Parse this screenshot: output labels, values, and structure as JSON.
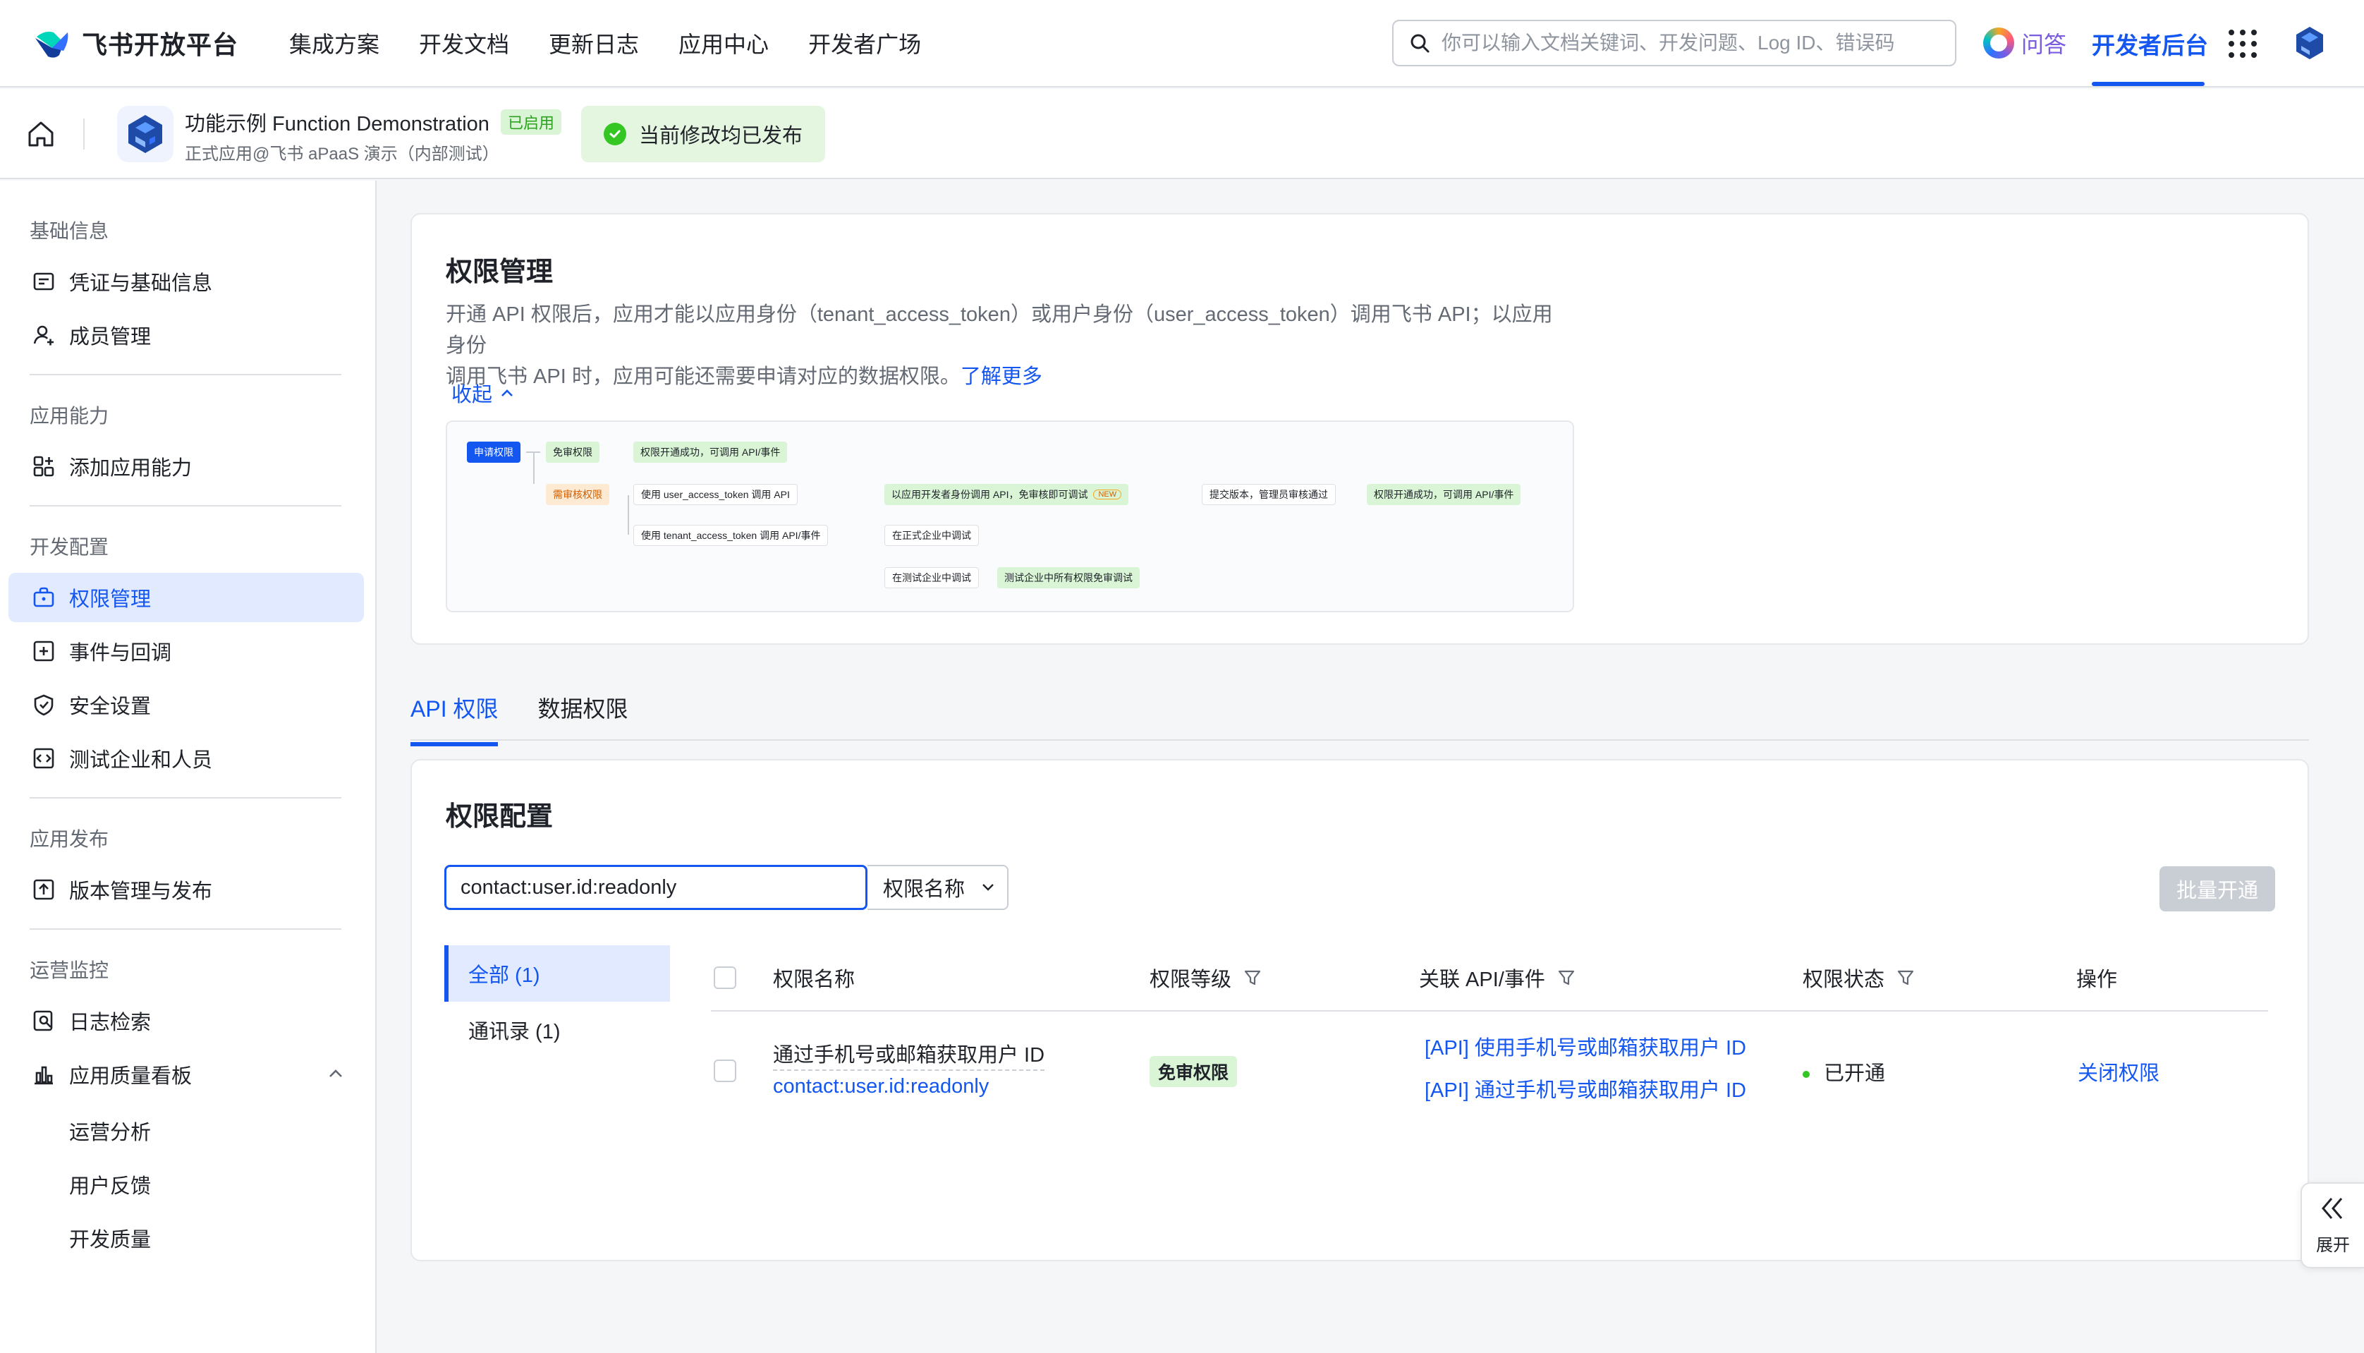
{
  "brand": {
    "name": "飞书开放平台",
    "brand_color": "#1456f0"
  },
  "nav": {
    "items": [
      "集成方案",
      "开发文档",
      "更新日志",
      "应用中心",
      "开发者广场"
    ],
    "search_placeholder": "你可以输入文档关键词、开发问题、Log ID、错误码",
    "qa_label": "问答",
    "console_label": "开发者后台"
  },
  "appbar": {
    "app_name": "功能示例 Function Demonstration",
    "app_status": "已启用",
    "app_sub": "正式应用@飞书 aPaaS 演示（内部测试）",
    "publish_status": "当前修改均已发布"
  },
  "sidebar": {
    "groups": [
      {
        "label": "基础信息",
        "items": [
          {
            "label": "凭证与基础信息",
            "icon": "credential-icon"
          },
          {
            "label": "成员管理",
            "icon": "member-icon"
          }
        ]
      },
      {
        "label": "应用能力",
        "items": [
          {
            "label": "添加应用能力",
            "icon": "capability-icon"
          }
        ]
      },
      {
        "label": "开发配置",
        "items": [
          {
            "label": "权限管理",
            "icon": "permission-icon",
            "active": true
          },
          {
            "label": "事件与回调",
            "icon": "event-icon"
          },
          {
            "label": "安全设置",
            "icon": "shield-icon"
          },
          {
            "label": "测试企业和人员",
            "icon": "test-icon"
          }
        ]
      },
      {
        "label": "应用发布",
        "items": [
          {
            "label": "版本管理与发布",
            "icon": "upload-icon"
          }
        ]
      },
      {
        "label": "运营监控",
        "items": [
          {
            "label": "日志检索",
            "icon": "log-icon"
          },
          {
            "label": "应用质量看板",
            "icon": "chart-icon"
          }
        ]
      }
    ],
    "sub_items": [
      "运营分析",
      "用户反馈",
      "开发质量"
    ]
  },
  "perm": {
    "title": "权限管理",
    "desc_line1": "开通 API 权限后，应用才能以应用身份（tenant_access_token）或用户身份（user_access_token）调用飞书 API；以应用身份",
    "desc_line2": "调用飞书 API 时，应用可能还需要申请对应的数据权限。",
    "learn_more": "了解更多",
    "collapse": "收起",
    "flow": {
      "apply": "申请权限",
      "free": "免审权限",
      "free_ok": "权限开通成功，可调用 API/事件",
      "review": "需审核权限",
      "user_token": "使用 user_access_token 调用 API",
      "dev_debug": "以应用开发者身份调用 API，免审核即可调试",
      "new": "NEW",
      "submit": "提交版本，管理员审核通过",
      "review_ok": "权限开通成功，可调用 API/事件",
      "tenant_token": "使用 tenant_access_token 调用 API/事件",
      "prod_debug": "在正式企业中调试",
      "test_debug": "在测试企业中调试",
      "test_free": "测试企业中所有权限免审调试"
    }
  },
  "tabs": [
    "API 权限",
    "数据权限"
  ],
  "config": {
    "title": "权限配置",
    "search_value": "contact:user.id:readonly",
    "select_value": "权限名称",
    "batch_button": "批量开通",
    "categories": [
      "全部 (1)",
      "通讯录 (1)"
    ]
  },
  "table": {
    "headers": [
      "权限名称",
      "权限等级",
      "关联 API/事件",
      "权限状态",
      "操作"
    ],
    "rows": [
      {
        "name": "通过手机号或邮箱获取用户 ID",
        "scope": "contact:user.id:readonly",
        "level": "免审权限",
        "api1": "[API] 使用手机号或邮箱获取用户 ID",
        "api2": "[API] 通过手机号或邮箱获取用户 ID",
        "status": "已开通",
        "action": "关闭权限"
      }
    ]
  },
  "expand_label": "展开"
}
